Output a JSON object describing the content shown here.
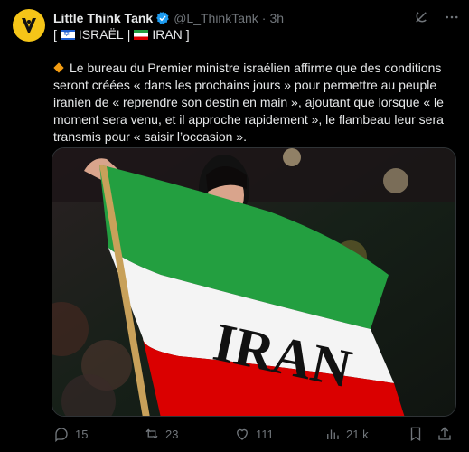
{
  "author": {
    "name": "Little Think Tank",
    "handle": "@L_ThinkTank",
    "separator": "·",
    "time": "3h",
    "avatar_icon": "tank-logo-icon",
    "avatar_color": "#f5c518",
    "verified_color": "#1d9bf0"
  },
  "subline": {
    "open": "[",
    "country1": "ISRAËL",
    "sep": "|",
    "country2": "IRAN",
    "close": "]"
  },
  "tweet": {
    "text": "Le bureau du Premier ministre israélien affirme que des conditions seront créées « dans les prochains jours » pour permettre au peuple iranien de « reprendre son destin en main », ajoutant que lorsque « le moment sera venu, et il approche rapidement », le flambeau leur sera transmis pour « saisir l’occasion »."
  },
  "media": {
    "flag_text": "IRAN",
    "colors": {
      "green": "#239f40",
      "white": "#ffffff",
      "red": "#da0000"
    }
  },
  "actions": {
    "replies": "15",
    "reposts": "23",
    "likes": "111",
    "views": "21 k"
  }
}
